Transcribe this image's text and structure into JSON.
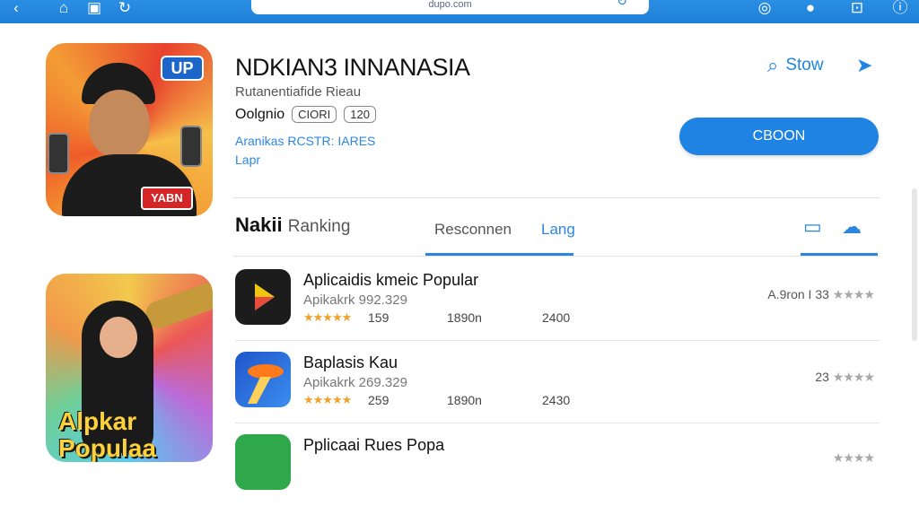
{
  "topbar": {
    "address": "dupo.com",
    "icons": [
      "back-icon",
      "game-icon",
      "image-icon",
      "refresh-icon",
      "shield-icon",
      "avatar",
      "robot-icon",
      "info-icon"
    ]
  },
  "featured_app": {
    "title": "NDKIAN3 INNANASIA",
    "subtitle": "Rutanentiafide Rieau",
    "meta_label": "Oolgnio",
    "pill1": "CIORI",
    "pill2": "120",
    "link1": "Aranikas RCSTR: IARES",
    "link2": "Lapr",
    "badge_top": "UP",
    "badge_bottom": "YABN"
  },
  "actions": {
    "search_label": "Stow",
    "primary_button": "CBOON"
  },
  "tabs": {
    "main_bold": "Nakii",
    "main_light": "Ranking",
    "tab1": "Resconnen",
    "tab2": "Lang"
  },
  "second_art": {
    "text_line1": "Alpkar",
    "text_line2": "Populaa"
  },
  "list": [
    {
      "title": "Aplicaidis kmeic Popular",
      "subtitle": "Apikakrk 992.329",
      "stars": "★★★★★",
      "rating": "159",
      "col2": "1890n",
      "col3": "2400",
      "right_text": "A.9ron I 33",
      "right_stars": "★★★★",
      "icon_color": "#1c1c1c"
    },
    {
      "title": "Baplasis Kau",
      "subtitle": "Apikakrk 269.329",
      "stars": "★★★★★",
      "rating": "259",
      "col2": "1890n",
      "col3": "2430",
      "right_text": "23",
      "right_stars": "★★★★",
      "icon_color": "#1f55c9"
    },
    {
      "title": "Pplicaai Rues Popa",
      "right_stars": "★★★★",
      "icon_color": "#2ea84a"
    }
  ]
}
